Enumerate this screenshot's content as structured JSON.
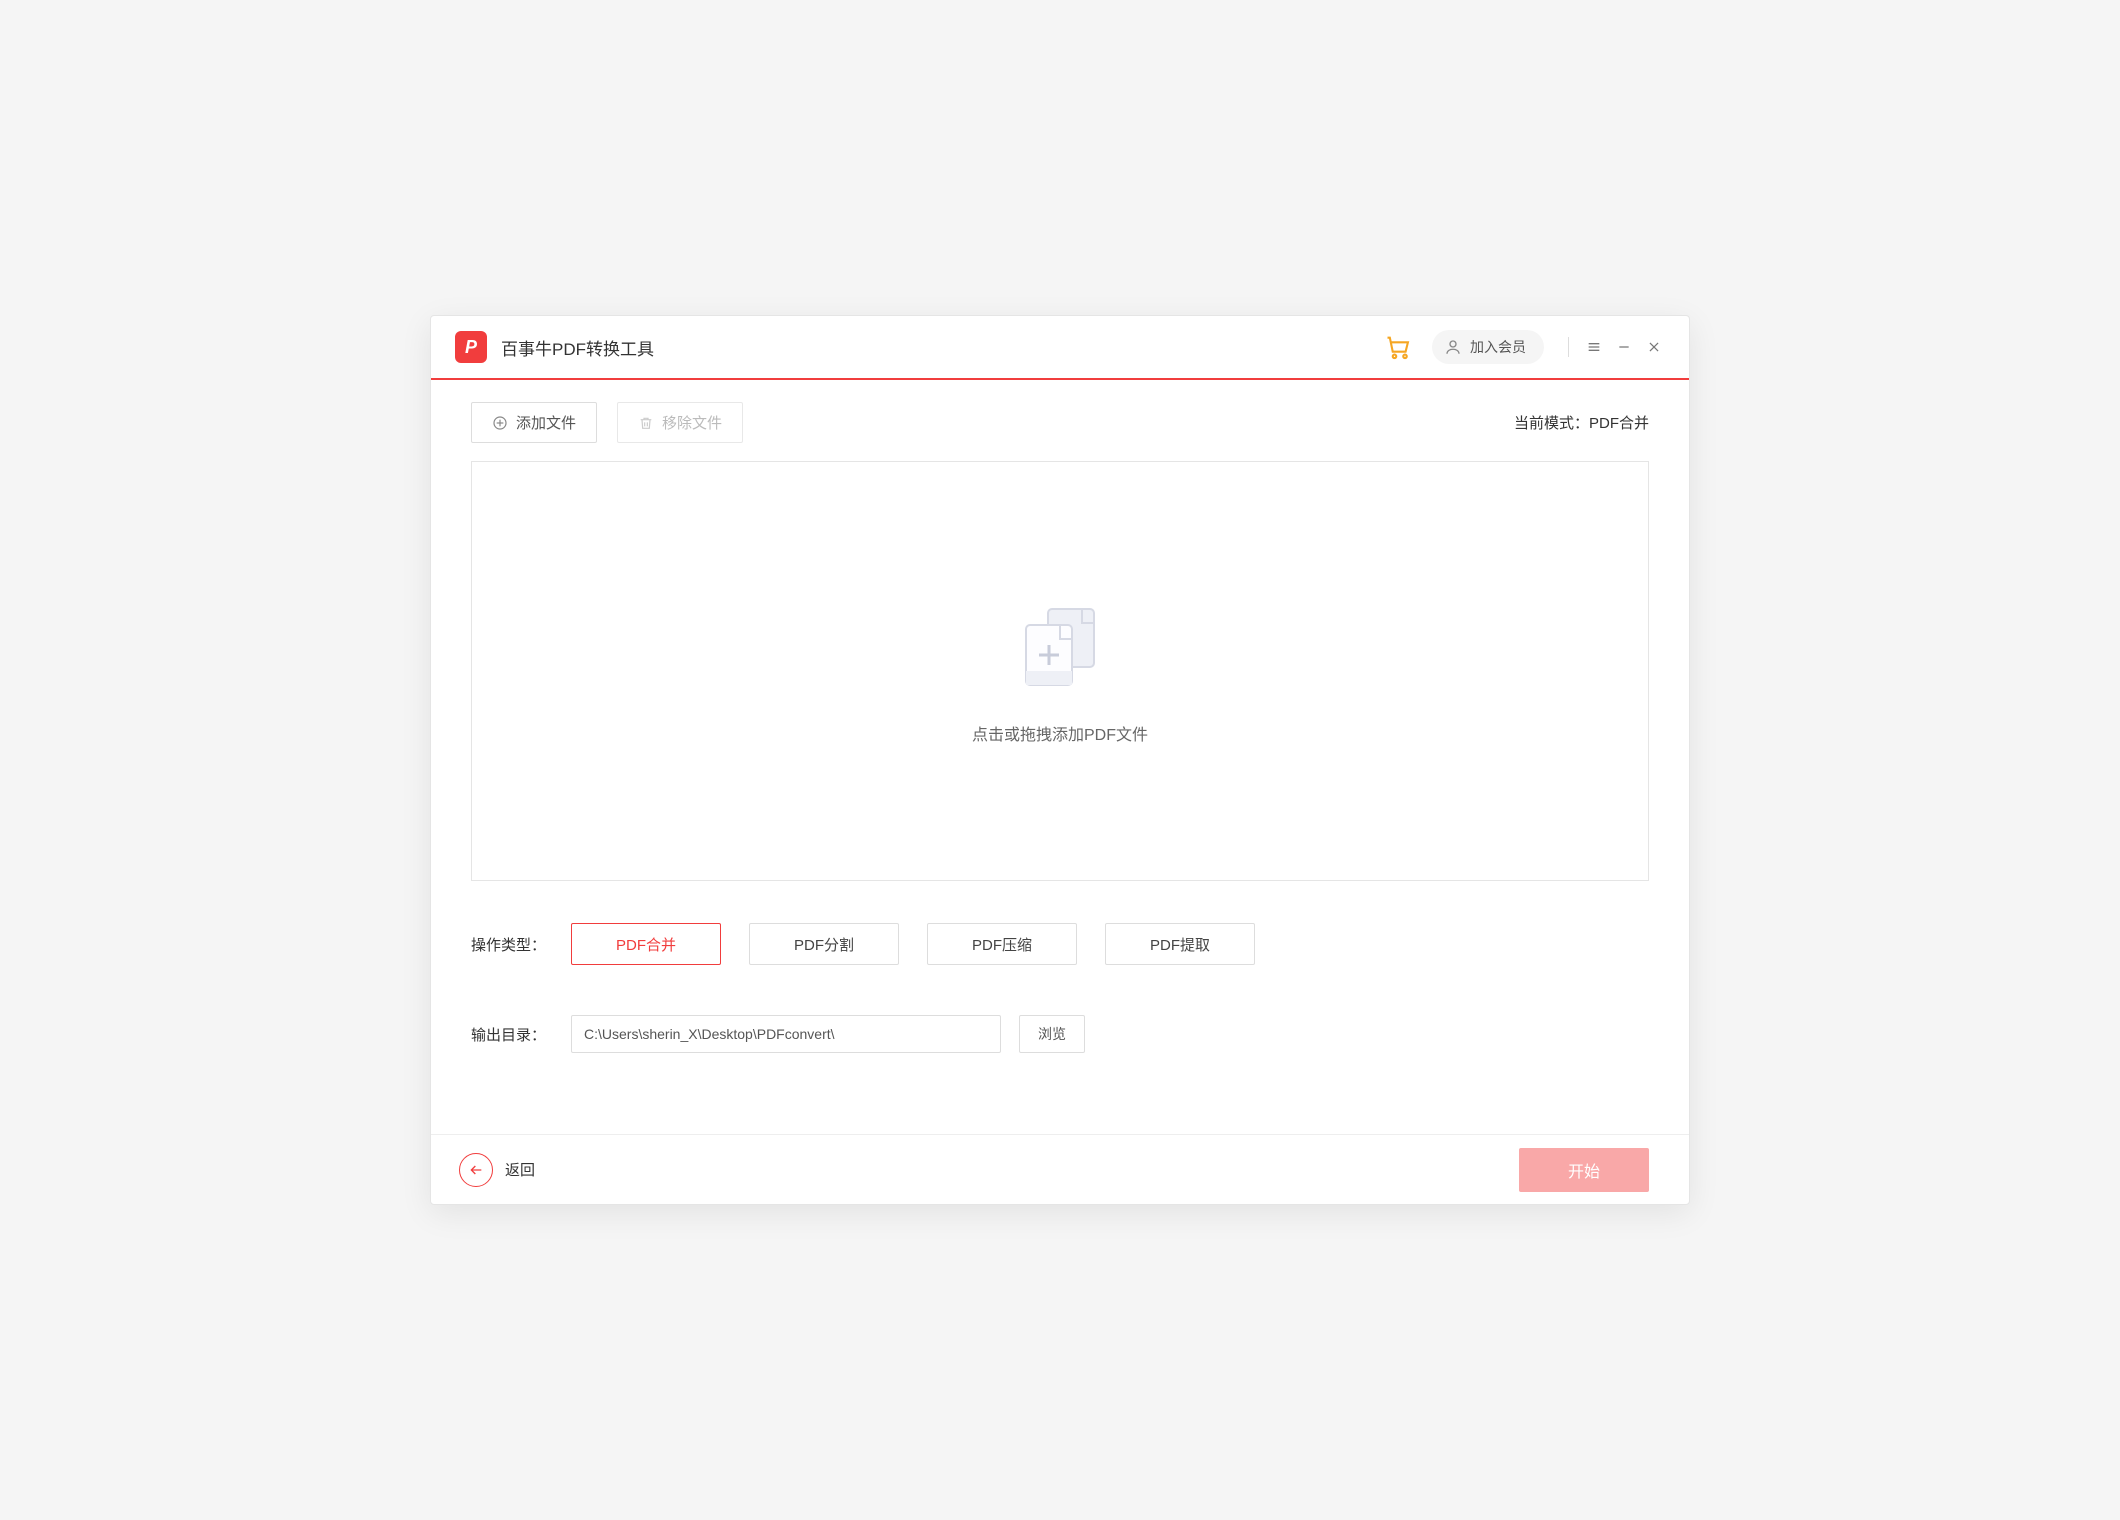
{
  "app": {
    "logo_letter": "P",
    "title": "百事牛PDF转换工具"
  },
  "titlebar": {
    "member_label": "加入会员"
  },
  "toolbar": {
    "add_file": "添加文件",
    "remove_file": "移除文件",
    "mode_prefix": "当前模式：",
    "mode_value": "PDF合并"
  },
  "dropzone": {
    "hint": "点击或拖拽添加PDF文件"
  },
  "operation": {
    "label": "操作类型：",
    "options": [
      "PDF合并",
      "PDF分割",
      "PDF压缩",
      "PDF提取"
    ],
    "active_index": 0
  },
  "output": {
    "label": "输出目录：",
    "path": "C:\\Users\\sherin_X\\Desktop\\PDFconvert\\",
    "browse": "浏览"
  },
  "footer": {
    "back": "返回",
    "start": "开始"
  },
  "colors": {
    "accent": "#f13d3d",
    "start_disabled": "#f9a8a8"
  }
}
